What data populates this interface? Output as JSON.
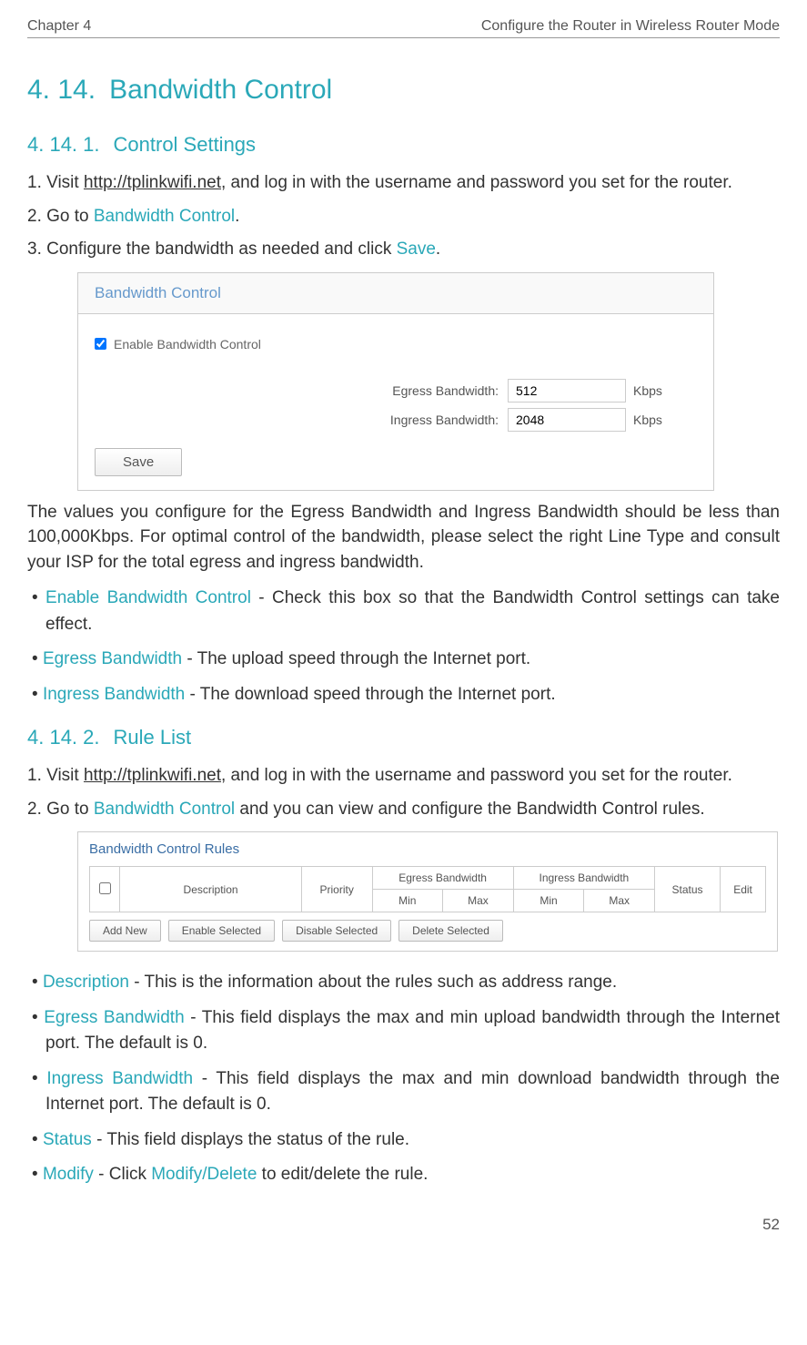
{
  "header": {
    "chapter": "Chapter 4",
    "title": "Configure the Router in Wireless Router Mode"
  },
  "h1": {
    "num": "4. 14.",
    "title": "Bandwidth Control"
  },
  "section1": {
    "h2": {
      "num": "4. 14. 1.",
      "title": "Control Settings"
    },
    "step1a": "1. Visit ",
    "step1link": "http://tplinkwifi.net",
    "step1b": ", and log in with the username and password you set for the router.",
    "step2a": "2. Go to ",
    "step2link": "Bandwidth Control",
    "step2b": ".",
    "step3a": "3. Configure the bandwidth as needed and click ",
    "step3link": "Save",
    "step3b": ".",
    "panel": {
      "title": "Bandwidth Control",
      "checkbox": "Enable Bandwidth Control",
      "row1": {
        "label": "Egress Bandwidth:",
        "value": "512",
        "unit": "Kbps"
      },
      "row2": {
        "label": "Ingress Bandwidth:",
        "value": "2048",
        "unit": "Kbps"
      },
      "save": "Save"
    },
    "note": "The values you configure for the Egress Bandwidth and Ingress Bandwidth should be less than 100,000Kbps. For optimal control of the bandwidth, please select the right Line Type and consult your ISP for the total egress and ingress bandwidth.",
    "b1": {
      "t": "Enable Bandwidth Control",
      "d": " - Check this box so that the Bandwidth Control settings can take effect."
    },
    "b2": {
      "t": "Egress Bandwidth",
      "d": " - The upload speed through the Internet port."
    },
    "b3": {
      "t": "Ingress Bandwidth",
      "d": " - The download speed through the Internet port."
    }
  },
  "section2": {
    "h2": {
      "num": "4. 14. 2.",
      "title": "Rule List"
    },
    "step1a": "1. Visit ",
    "step1link": "http://tplinkwifi.net",
    "step1b": ", and log in with the username and password you set for the router.",
    "step2a": "2. Go to ",
    "step2link": "Bandwidth Control",
    "step2b": " and you can view and configure the Bandwidth Control rules.",
    "panel": {
      "title": "Bandwidth Control Rules",
      "headers": {
        "description": "Description",
        "priority": "Priority",
        "egress": "Egress Bandwidth",
        "ingress": "Ingress Bandwidth",
        "min": "Min",
        "max": "Max",
        "status": "Status",
        "edit": "Edit"
      },
      "buttons": {
        "add": "Add New",
        "enable": "Enable Selected",
        "disable": "Disable Selected",
        "delete": "Delete Selected"
      }
    },
    "b1": {
      "t": "Description",
      "d": " - This is the information about the rules such as address range."
    },
    "b2": {
      "t": "Egress Bandwidth",
      "d": " - This field displays the max and min upload bandwidth through the Internet port. The default is 0."
    },
    "b3": {
      "t": "Ingress Bandwidth",
      "d": " - This field displays the max and min download bandwidth through the Internet port. The default is 0."
    },
    "b4": {
      "t": "Status",
      "d": " - This field displays the status of the rule."
    },
    "b5": {
      "t": "Modify",
      "d1": " - Click ",
      "link": "Modify/Delete",
      "d2": " to edit/delete the rule."
    }
  },
  "page": "52"
}
